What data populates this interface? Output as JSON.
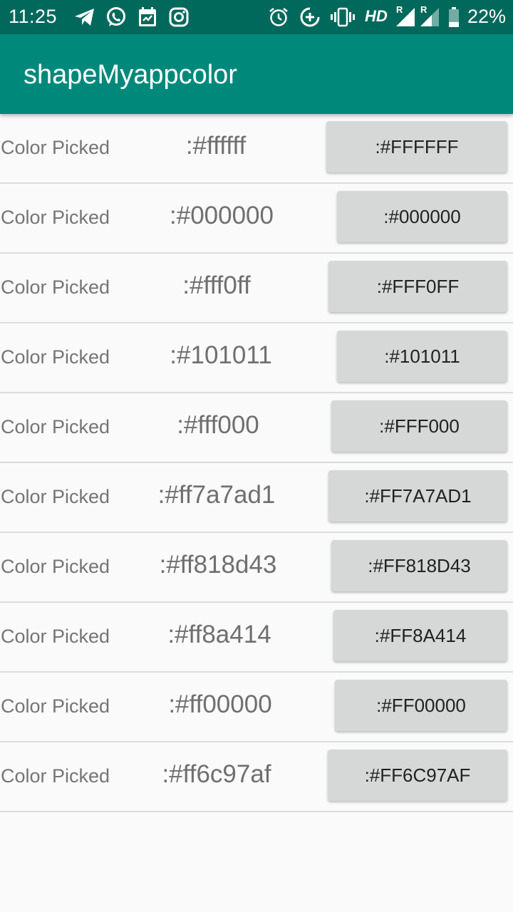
{
  "status_bar": {
    "time": "11:25",
    "network": "HD",
    "roaming_1": "R",
    "roaming_2": "R",
    "battery": "22%",
    "icons": [
      "telegram-icon",
      "whatsapp-icon",
      "calendar-icon",
      "instagram-icon",
      "alarm-icon",
      "data-saver-icon",
      "vibrate-icon",
      "signal-icon",
      "battery-icon"
    ]
  },
  "app_bar": {
    "title": "shapeMyappcolor",
    "color": "#00897b",
    "status_color": "#00695c"
  },
  "rows": [
    {
      "label": "Color Picked",
      "hex": ":#ffffff",
      "button": ":#FFFFFF"
    },
    {
      "label": "Color Picked",
      "hex": ":#000000",
      "button": ":#000000"
    },
    {
      "label": "Color Picked",
      "hex": ":#fff0ff",
      "button": ":#FFF0FF"
    },
    {
      "label": "Color Picked",
      "hex": ":#101011",
      "button": ":#101011"
    },
    {
      "label": "Color Picked",
      "hex": ":#fff000",
      "button": ":#FFF000"
    },
    {
      "label": "Color Picked",
      "hex": ":#ff7a7ad1",
      "button": ":#FF7A7AD1"
    },
    {
      "label": "Color Picked",
      "hex": ":#ff818d43",
      "button": ":#FF818D43"
    },
    {
      "label": "Color Picked",
      "hex": ":#ff8a414",
      "button": ":#FF8A414"
    },
    {
      "label": "Color Picked",
      "hex": ":#ff00000",
      "button": ":#FF00000"
    },
    {
      "label": "Color Picked",
      "hex": ":#ff6c97af",
      "button": ":#FF6C97AF"
    }
  ]
}
